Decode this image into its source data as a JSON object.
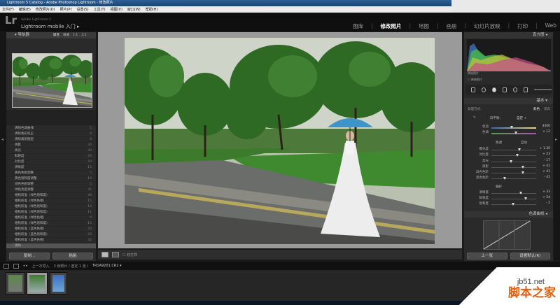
{
  "window": {
    "title": "Lightroom 5 Catalog - Adobe Photoshop Lightroom - 修改照片"
  },
  "menu": [
    "文件(F)",
    "编辑(E)",
    "修改照片(D)",
    "照片(P)",
    "设置(S)",
    "工具(T)",
    "视图(V)",
    "窗口(W)",
    "帮助(H)"
  ],
  "identity": {
    "logo": "Lr",
    "line1": "Adobe Lightroom 5",
    "line2": "Lightroom mobile 入门 ▸"
  },
  "modules": [
    {
      "label": "图库",
      "active": false
    },
    {
      "label": "修改照片",
      "active": true
    },
    {
      "label": "地图",
      "active": false
    },
    {
      "label": "画册",
      "active": false
    },
    {
      "label": "幻灯片放映",
      "active": false
    },
    {
      "label": "打印",
      "active": false
    },
    {
      "label": "Web",
      "active": false
    }
  ],
  "navigator": {
    "title": "导航器",
    "zoom": [
      "适合",
      "填满",
      "1:1",
      "3:1"
    ]
  },
  "history": [
    {
      "label": "清除色调曲线",
      "v1": "",
      "v2": "5"
    },
    {
      "label": "清除色彩校正",
      "v1": "",
      "v2": "4"
    },
    {
      "label": "清除裁剪图层",
      "v1": "",
      "v2": "3"
    },
    {
      "label": "阴影",
      "v1": "",
      "v2": "43"
    },
    {
      "label": "高光",
      "v1": "",
      "v2": "30"
    },
    {
      "label": "鲜艳度",
      "v1": "",
      "v2": "26"
    },
    {
      "label": "对比度",
      "v1": "",
      "v2": "20"
    },
    {
      "label": "清晰度",
      "v1": "",
      "v2": "15"
    },
    {
      "label": "黄色色相调整",
      "v1": "",
      "v2": "5"
    },
    {
      "label": "黄色饱和度调整",
      "v1": "",
      "v2": "14"
    },
    {
      "label": "绿色色相调整",
      "v1": "",
      "v2": "5"
    },
    {
      "label": "绿色亮度调整",
      "v1": "",
      "v2": "31"
    },
    {
      "label": "相机校准（绿色饱和度）",
      "v1": "",
      "v2": "39"
    },
    {
      "label": "相机校准（绿色色相）",
      "v1": "",
      "v2": "15"
    },
    {
      "label": "相机校准（绿色饱和度）",
      "v1": "",
      "v2": "14"
    },
    {
      "label": "相机校准（绿色饱和度）",
      "v1": "",
      "v2": "11"
    },
    {
      "label": "相机校准（绿色色相）",
      "v1": "",
      "v2": "9"
    },
    {
      "label": "相机校准（绿色饱和度）",
      "v1": "",
      "v2": "15"
    },
    {
      "label": "相机校准（蓝色色相）",
      "v1": "",
      "v2": "20"
    },
    {
      "label": "相机校准（蓝色饱和度）",
      "v1": "",
      "v2": "23"
    },
    {
      "label": "相机校准（蓝色色相）",
      "v1": "",
      "v2": "32"
    },
    {
      "label": "清除",
      "v1": "",
      "v2": ""
    }
  ],
  "left_buttons": {
    "copy": "复制...",
    "paste": "粘贴"
  },
  "toolbar": {
    "label": "软打样"
  },
  "right": {
    "histogram_title": "直方图",
    "hist_caption1": "原始照片",
    "hist_caption2": "☐ 原始照片",
    "basic_title": "基本",
    "treatment_label": "处理方式：",
    "treatment_options": [
      {
        "label": "彩色",
        "on": true
      },
      {
        "label": "黑白",
        "on": false
      }
    ],
    "wb_label": "白平衡：",
    "wb_value": "自定 ÷",
    "tone_label": "色调",
    "auto_label": "自动",
    "presence_label": "偏好",
    "sliders": [
      {
        "label": "色温",
        "value": "3400",
        "pos": 0.45,
        "grad": "temp"
      },
      {
        "label": "色调",
        "value": "+ 12",
        "pos": 0.55,
        "grad": "tint"
      },
      {
        "label": "曝光度",
        "value": "+ 1.30",
        "pos": 0.62
      },
      {
        "label": "对比度",
        "value": "+ 23",
        "pos": 0.58
      },
      {
        "label": "高光",
        "value": "- 17",
        "pos": 0.44
      },
      {
        "label": "阴影",
        "value": "+ 41",
        "pos": 0.7
      },
      {
        "label": "白色色阶",
        "value": "+ 41",
        "pos": 0.7
      },
      {
        "label": "黑色色阶",
        "value": "- 41",
        "pos": 0.3
      },
      {
        "label": "清晰度",
        "value": "+ 33",
        "pos": 0.66
      },
      {
        "label": "鲜艳度",
        "value": "+ 54",
        "pos": 0.77
      },
      {
        "label": "饱和度",
        "value": "- 2",
        "pos": 0.49
      }
    ],
    "curve_title": "色调曲线",
    "btn_prev": "上一张",
    "btn_reset": "设置默认(R)"
  },
  "filmstrip": {
    "nav": "上一次导入",
    "info": "3 张照片 / 选定 1 张 /",
    "file": "TR1A9201.CR2 ▾"
  },
  "watermark": {
    "site": "jb51.net",
    "title": "脚本之家"
  }
}
